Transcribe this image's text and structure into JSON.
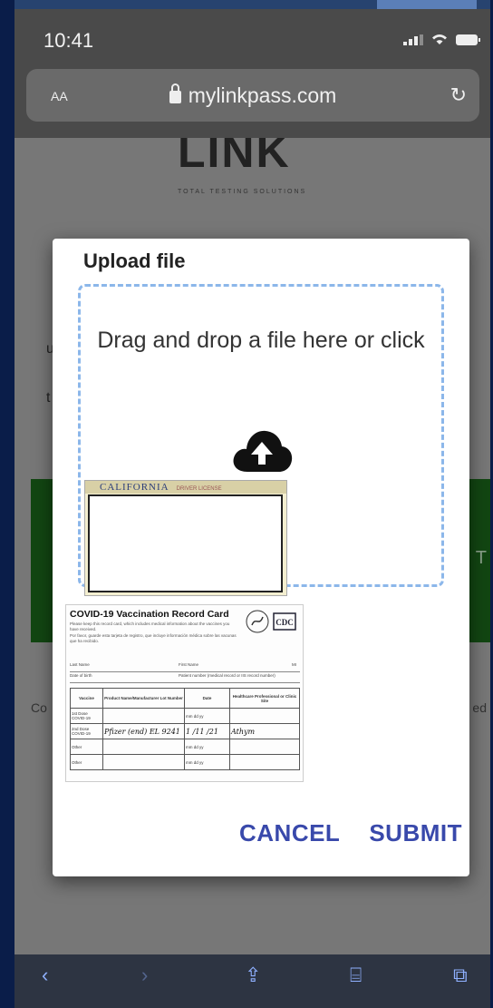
{
  "status_bar": {
    "time": "10:41"
  },
  "browser": {
    "text_size_label": "AA",
    "url": "mylinkpass.com",
    "reload_icon": "reload-icon"
  },
  "background_page": {
    "logo_text": "LINK",
    "tagline": "TOTAL TESTING SOLUTIONS",
    "partial_left_1": "u",
    "partial_left_2": "t",
    "partial_right_button": "T",
    "partial_left_footer": "Co",
    "partial_right_footer": "ed"
  },
  "dialog": {
    "title": "Upload file",
    "dropzone_text": "Drag and drop a file here or click",
    "upload_icon": "cloud-upload-icon",
    "cancel_label": "CANCEL",
    "submit_label": "SUBMIT",
    "license_card": {
      "state": "CALIFORNIA",
      "label": "DRIVER LICENSE"
    },
    "vaccination_card": {
      "title": "COVID-19 Vaccination Record Card",
      "intro_en": "Please keep this record card, which includes medical information about the vaccines you have received.",
      "intro_es": "Por favor, guarde esta tarjeta de registro, que incluye información médica sobre las vacunas que ha recibido.",
      "logo": "CDC",
      "field_last_name": "Last Name",
      "field_first_name": "First Name",
      "field_mi": "MI",
      "field_dob": "Date of birth",
      "field_patient_number": "Patient number (medical record or IIS record number)",
      "headers": [
        "Vaccine",
        "Product Name/Manufacturer Lot Number",
        "Date",
        "Healthcare Professional or Clinic Site"
      ],
      "rows": [
        {
          "vaccine": "1st Dose COVID-19",
          "product": "",
          "date": "mm dd yy",
          "site": ""
        },
        {
          "vaccine": "2nd Dose COVID-19",
          "product": "Pfizer (end) EL 9241",
          "date": "1 /11 /21",
          "site": "Athym"
        },
        {
          "vaccine": "Other",
          "product": "",
          "date": "mm dd yy",
          "site": ""
        },
        {
          "vaccine": "Other",
          "product": "",
          "date": "mm dd yy",
          "site": ""
        }
      ]
    }
  },
  "toolbar": {
    "icons": [
      "back-icon",
      "forward-icon",
      "share-icon",
      "bookmarks-icon",
      "tabs-icon"
    ]
  },
  "colors": {
    "accent": "#3949ab",
    "dropzone_border": "#8cb7ea",
    "bg_button": "#124612"
  }
}
